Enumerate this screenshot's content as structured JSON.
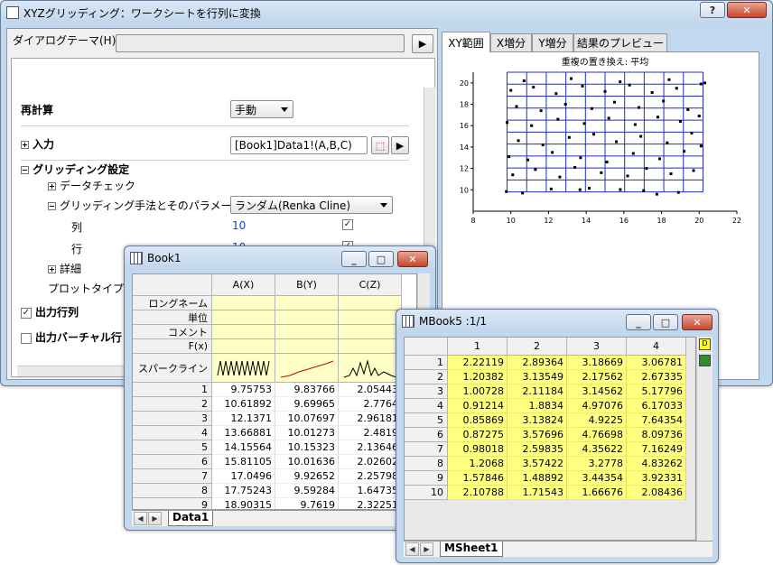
{
  "dialog": {
    "title": "XYZグリッディング：ワークシートを行列に変換",
    "theme_label": "ダイアログテーマ(H)",
    "recalc_label": "再計算",
    "recalc_value": "手動",
    "input_label": "入力",
    "input_value": "[Book1]Data1!(A,B,C)",
    "gridding_label": "グリッディング設定",
    "datacheck_label": "データチェック",
    "method_label": "グリッディング手法とそのパラメータ",
    "method_value": "ランダム(Renka Cline)",
    "cols_label": "列",
    "cols_value": "10",
    "rows_label": "行",
    "rows_value": "10",
    "details_label": "詳細",
    "plottype_label": "プロットタイプのプ",
    "output_matrix_label": "出力行列",
    "output_virtual_label": "出力バーチャル行",
    "tabs": [
      "XY範囲",
      "X増分",
      "Y増分",
      "結果のプレビュー"
    ]
  },
  "chart_data": {
    "type": "scatter",
    "title": "重複の置き換え: 平均",
    "xlim": [
      8,
      22
    ],
    "ylim": [
      8,
      21
    ],
    "xticks": [
      8,
      10,
      12,
      14,
      16,
      18,
      20,
      22
    ],
    "yticks": [
      10,
      12,
      14,
      16,
      18,
      20
    ],
    "grid_x": [
      9.8,
      10.84,
      11.88,
      12.92,
      13.96,
      15.0,
      16.04,
      17.08,
      18.12,
      19.16,
      20.2
    ],
    "grid_y": [
      9.8,
      10.92,
      12.04,
      13.16,
      14.28,
      15.4,
      16.52,
      17.64,
      18.76,
      19.88,
      21.0
    ],
    "points": [
      [
        9.76,
        9.84
      ],
      [
        10.62,
        9.7
      ],
      [
        12.14,
        10.08
      ],
      [
        13.67,
        10.01
      ],
      [
        14.16,
        10.15
      ],
      [
        15.81,
        10.02
      ],
      [
        17.05,
        9.93
      ],
      [
        17.75,
        9.59
      ],
      [
        18.9,
        9.76
      ],
      [
        10.1,
        11.4
      ],
      [
        11.3,
        11.9
      ],
      [
        12.6,
        11.2
      ],
      [
        13.4,
        12.1
      ],
      [
        14.8,
        11.6
      ],
      [
        16.2,
        11.3
      ],
      [
        17.2,
        12.0
      ],
      [
        18.5,
        11.5
      ],
      [
        19.7,
        11.8
      ],
      [
        9.9,
        13.1
      ],
      [
        10.9,
        12.8
      ],
      [
        12.2,
        13.5
      ],
      [
        13.7,
        13.0
      ],
      [
        15.1,
        12.6
      ],
      [
        16.5,
        13.4
      ],
      [
        17.9,
        12.9
      ],
      [
        19.2,
        13.6
      ],
      [
        20.1,
        14.1
      ],
      [
        10.4,
        14.6
      ],
      [
        11.7,
        14.2
      ],
      [
        13.1,
        14.9
      ],
      [
        14.4,
        15.2
      ],
      [
        15.6,
        14.5
      ],
      [
        16.9,
        15.0
      ],
      [
        18.3,
        14.4
      ],
      [
        19.6,
        15.3
      ],
      [
        9.8,
        16.3
      ],
      [
        11.1,
        16.0
      ],
      [
        12.5,
        16.6
      ],
      [
        13.9,
        16.2
      ],
      [
        15.2,
        16.7
      ],
      [
        16.6,
        16.1
      ],
      [
        17.8,
        16.8
      ],
      [
        19.0,
        16.4
      ],
      [
        20.0,
        16.9
      ],
      [
        10.3,
        17.8
      ],
      [
        11.6,
        17.4
      ],
      [
        12.9,
        18.0
      ],
      [
        14.3,
        17.6
      ],
      [
        15.5,
        18.2
      ],
      [
        16.8,
        17.7
      ],
      [
        18.1,
        18.3
      ],
      [
        19.4,
        17.5
      ],
      [
        10.0,
        19.3
      ],
      [
        11.2,
        19.6
      ],
      [
        12.4,
        19.0
      ],
      [
        13.8,
        19.7
      ],
      [
        15.0,
        19.2
      ],
      [
        16.3,
        19.8
      ],
      [
        17.5,
        19.1
      ],
      [
        18.8,
        19.5
      ],
      [
        20.1,
        19.9
      ],
      [
        10.7,
        20.2
      ],
      [
        13.2,
        20.4
      ],
      [
        15.8,
        20.1
      ],
      [
        18.4,
        20.3
      ],
      [
        20.3,
        20.0
      ]
    ]
  },
  "book1": {
    "title": "Book1",
    "columns": [
      "A(X)",
      "B(Y)",
      "C(Z)"
    ],
    "row_labels": [
      "ロングネーム",
      "単位",
      "コメント",
      "F(x)",
      "スパークライン"
    ],
    "rows": [
      [
        "1",
        "9.75753",
        "9.83766",
        "2.05443"
      ],
      [
        "2",
        "10.61892",
        "9.69965",
        "2.7764"
      ],
      [
        "3",
        "12.1371",
        "10.07697",
        "2.96181"
      ],
      [
        "4",
        "13.66881",
        "10.01273",
        "2.4819"
      ],
      [
        "5",
        "14.15564",
        "10.15323",
        "2.13646"
      ],
      [
        "6",
        "15.81105",
        "10.01636",
        "2.02602"
      ],
      [
        "7",
        "17.0496",
        "9.92652",
        "2.25798"
      ],
      [
        "8",
        "17.75243",
        "9.59284",
        "1.64735"
      ],
      [
        "9",
        "18.90315",
        "9.7619",
        "2.32251"
      ]
    ],
    "sheet_tab": "Data1"
  },
  "mbook": {
    "title": "MBook5 :1/1",
    "columns": [
      "1",
      "2",
      "3",
      "4"
    ],
    "rows": [
      [
        "1",
        "2.22119",
        "2.89364",
        "3.18669",
        "3.06781"
      ],
      [
        "2",
        "1.20382",
        "3.13549",
        "2.17562",
        "2.67335"
      ],
      [
        "3",
        "1.00728",
        "2.11184",
        "3.14562",
        "5.17796"
      ],
      [
        "4",
        "0.91214",
        "1.8834",
        "4.97076",
        "6.17033"
      ],
      [
        "5",
        "0.85869",
        "3.13824",
        "4.9225",
        "7.64354"
      ],
      [
        "6",
        "0.87275",
        "3.57696",
        "4.76698",
        "8.09736"
      ],
      [
        "7",
        "0.98018",
        "2.59835",
        "4.35622",
        "7.16249"
      ],
      [
        "8",
        "1.2068",
        "3.57422",
        "3.2778",
        "4.83262"
      ],
      [
        "9",
        "1.57846",
        "1.48892",
        "3.44354",
        "3.92331"
      ],
      [
        "10",
        "2.10788",
        "1.71543",
        "1.66676",
        "2.08436"
      ]
    ],
    "sheet_tab": "MSheet1",
    "cell_color": "#ffff80"
  },
  "icons": {
    "help": "?",
    "minimize": "▭",
    "maximize": "□",
    "close": "✕"
  }
}
